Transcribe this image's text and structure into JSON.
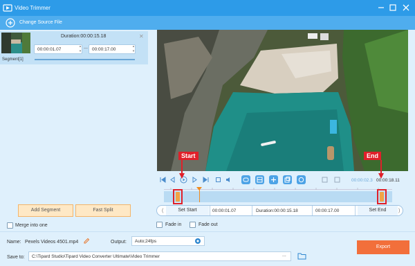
{
  "window": {
    "title": "Video Trimmer"
  },
  "source": {
    "change_label": "Change Source File"
  },
  "segment": {
    "label": "Segment[1]",
    "duration": "Duration:00:00:15.18",
    "start": "00:00:01.07",
    "end": "00:00:17.00"
  },
  "left_buttons": {
    "add_segment": "Add Segment",
    "fast_split": "Fast Split"
  },
  "merge_label": "Merge into one",
  "player": {
    "current_time": "00:00:02.3",
    "total_time": "00:00:18.11"
  },
  "callouts": {
    "start": "Start",
    "end": "End"
  },
  "set_row": {
    "set_start": "Set Start",
    "start_value": "00:00:01.07",
    "duration_value": "Duration:00:00:15.18",
    "end_value": "00:00:17.00",
    "set_end": "Set End"
  },
  "fades": {
    "fade_in": "Fade in",
    "fade_out": "Fade out"
  },
  "output": {
    "name_label": "Name:",
    "name_value": "Pexels Videos 4501.mp4",
    "output_label": "Output:",
    "output_value": "Auto;24fps",
    "save_label": "Save to:",
    "save_path": "C:\\Tipard Studio\\Tipard Video Converter Ultimate\\Video Trimmer",
    "browse": "...",
    "export": "Export"
  },
  "colors": {
    "titlebar": "#2d9be8",
    "accent": "#4da3e6",
    "export": "#f26f3b",
    "callout": "#e0202a",
    "handle": "#f2a445"
  },
  "icons": [
    "app-icon",
    "minimize-icon",
    "maximize-icon",
    "close-icon",
    "add-source-icon",
    "edit-name-icon",
    "settings-icon",
    "folder-icon"
  ]
}
